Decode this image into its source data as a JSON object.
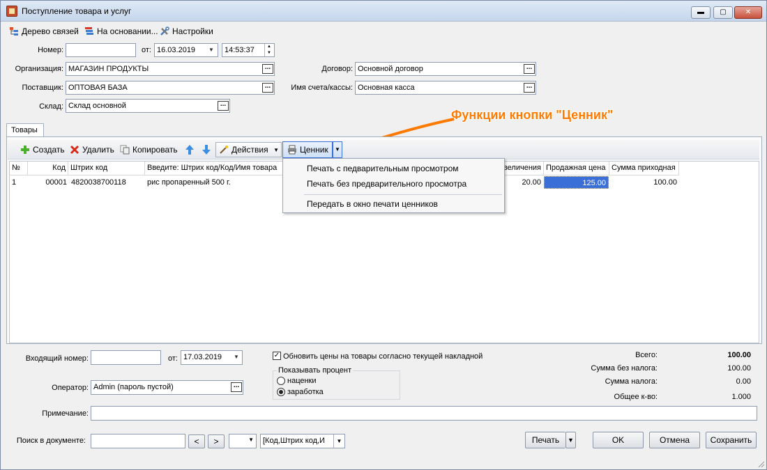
{
  "window": {
    "title": "Поступление товара и услуг",
    "controls": {
      "minimize": "▬",
      "maximize": "▢",
      "close": "✕"
    }
  },
  "toolbar": {
    "tree": "Дерево связей",
    "based_on": "На основании...",
    "settings": "Настройки"
  },
  "form": {
    "number_label": "Номер:",
    "number_value": "",
    "from_label": "от:",
    "date_value": "16.03.2019",
    "time_value": "14:53:37",
    "org_label": "Организация:",
    "org_value": "МАГАЗИН ПРОДУКТЫ",
    "supplier_label": "Поставщик:",
    "supplier_value": "ОПТОВАЯ БАЗА",
    "warehouse_label": "Склад:",
    "warehouse_value": "Склад основной",
    "contract_label": "Договор:",
    "contract_value": "Основной договор",
    "account_label": "Имя счета/кассы:",
    "account_value": "Основная касса"
  },
  "annotation": "Функции кнопки \"Ценник\"",
  "tabs": {
    "goods": "Товары"
  },
  "grid_toolbar": {
    "create": "Создать",
    "delete": "Удалить",
    "copy": "Копировать",
    "actions": "Действия",
    "pricetag": "Ценник"
  },
  "grid": {
    "headers": {
      "num": "№",
      "code": "Код",
      "barcode": "Штрих код",
      "name": "Введите: Штрих код/Код/Имя товара",
      "increase": "величения",
      "sale_price": "Продажная цена",
      "sum": "Сумма приходная"
    },
    "rows": [
      {
        "num": "1",
        "code": "00001",
        "barcode": "4820038700118",
        "name": "рис пропаренный 500 г.",
        "increase": "20.00",
        "sale_price": "125.00",
        "sum": "100.00"
      }
    ]
  },
  "menu": {
    "item1": "Печать с педварительным просмотром",
    "item2": "Печать без предварительного просмотра",
    "item3": "Передать в окно печати ценников"
  },
  "bottom": {
    "incoming_label": "Входящий номер:",
    "incoming_value": "",
    "from_label": "от:",
    "incoming_date": "17.03.2019",
    "update_prices": "Обновить цены на товары согласно текущей накладной",
    "show_percent": "Показывать процент",
    "markup": "наценки",
    "earnings": "заработка",
    "operator_label": "Оператор:",
    "operator_value": "Admin (пароль пустой)",
    "note_label": "Примечание:",
    "note_value": "",
    "search_label": "Поиск в документе:",
    "search_value": "",
    "search_prev": "<",
    "search_next": ">",
    "search_field": "[Код,Штрих код,И"
  },
  "totals": {
    "total_label": "Всего:",
    "total_value": "100.00",
    "without_tax_label": "Сумма без налога:",
    "without_tax_value": "100.00",
    "tax_label": "Сумма налога:",
    "tax_value": "0.00",
    "qty_label": "Общее к-во:",
    "qty_value": "1.000"
  },
  "buttons": {
    "print": "Печать",
    "ok": "OK",
    "cancel": "Отмена",
    "save": "Сохранить"
  },
  "colors": {
    "annotation": "#ff7a00",
    "selection": "#3a6fd8"
  }
}
